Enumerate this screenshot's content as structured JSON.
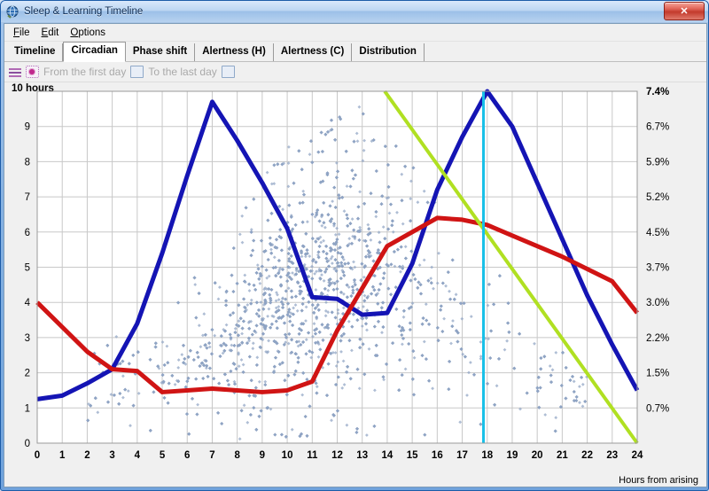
{
  "window": {
    "title": "Sleep & Learning Timeline",
    "app_icon": "globe-icon",
    "close_label": "✕"
  },
  "menubar": {
    "items": [
      {
        "label": "File",
        "mnemonic": "F"
      },
      {
        "label": "Edit",
        "mnemonic": "E"
      },
      {
        "label": "Options",
        "mnemonic": "O"
      }
    ]
  },
  "tabs": [
    {
      "label": "Timeline",
      "active": false
    },
    {
      "label": "Circadian",
      "active": true
    },
    {
      "label": "Phase shift",
      "active": false
    },
    {
      "label": "Alertness (H)",
      "active": false
    },
    {
      "label": "Alertness (C)",
      "active": false
    },
    {
      "label": "Distribution",
      "active": false
    }
  ],
  "toolbar": {
    "lines_icon": "lines-icon",
    "from_icon": "burst-icon",
    "from_label": "From the first day",
    "from_calendar_icon": "calendar-icon",
    "to_label": "To the last day",
    "to_calendar_icon": "calendar-icon"
  },
  "chart_data": {
    "type": "line",
    "title": "",
    "xlabel": "Hours from arising",
    "ylabel": "10 hours",
    "xlim": [
      0,
      24
    ],
    "ylim": [
      0,
      10
    ],
    "grid": true,
    "legend": "none",
    "x_ticks": [
      0,
      1,
      2,
      3,
      4,
      5,
      6,
      7,
      8,
      9,
      10,
      11,
      12,
      13,
      14,
      15,
      16,
      17,
      18,
      19,
      20,
      21,
      22,
      23,
      24
    ],
    "y_ticks_left": [
      "0",
      "1",
      "2",
      "3",
      "4",
      "5",
      "6",
      "7",
      "8",
      "9",
      "10 hours"
    ],
    "y_ticks_right": [
      "0.7%",
      "1.5%",
      "2.2%",
      "3.0%",
      "3.7%",
      "4.5%",
      "5.2%",
      "5.9%",
      "6.7%",
      "7.4%"
    ],
    "y_right_values": [
      0.7,
      1.5,
      2.2,
      3.0,
      3.7,
      4.5,
      5.2,
      5.9,
      6.7,
      7.4
    ],
    "y_right_positions": [
      1,
      2,
      3,
      4,
      5,
      6,
      7,
      8,
      9,
      10
    ],
    "series": [
      {
        "name": "circadian-blue",
        "color": "#1414b4",
        "width": 5,
        "x": [
          0,
          1,
          2,
          3,
          4,
          5,
          6,
          7,
          8,
          9,
          10,
          11,
          12,
          13,
          14,
          15,
          16,
          17,
          18,
          19,
          20,
          21,
          22,
          23,
          24
        ],
        "y": [
          1.25,
          1.35,
          1.7,
          2.1,
          3.4,
          5.4,
          7.6,
          9.7,
          8.6,
          7.4,
          6.1,
          4.15,
          4.1,
          3.65,
          3.7,
          5.1,
          7.2,
          8.7,
          10.0,
          9.0,
          7.4,
          5.8,
          4.2,
          2.8,
          1.5
        ]
      },
      {
        "name": "homeostatic-red",
        "color": "#d01414",
        "width": 5,
        "x": [
          0,
          1,
          2,
          3,
          4,
          5,
          6,
          7,
          8,
          9,
          10,
          11,
          12,
          13,
          14,
          15,
          16,
          17,
          18,
          19,
          20,
          21,
          22,
          23,
          24
        ],
        "y": [
          4.0,
          3.3,
          2.6,
          2.1,
          2.05,
          1.45,
          1.5,
          1.55,
          1.5,
          1.45,
          1.5,
          1.75,
          3.2,
          4.4,
          5.6,
          6.0,
          6.4,
          6.35,
          6.2,
          5.9,
          5.6,
          5.3,
          4.95,
          4.6,
          3.7
        ]
      },
      {
        "name": "alertness-green",
        "color": "#b0e022",
        "width": 4,
        "x": [
          13.9,
          24
        ],
        "y": [
          10.0,
          0.0
        ]
      },
      {
        "name": "current-time-marker",
        "color": "#18c0e8",
        "width": 3,
        "x": [
          17.85,
          17.85
        ],
        "y": [
          0.0,
          10.0
        ]
      }
    ],
    "scatter": {
      "name": "sleep-samples",
      "color": "#8fa3c4",
      "marker": "diamond",
      "size": 3,
      "density_note": "dense cloud concentrated between x=4 and x=20, centered around y=2..6"
    }
  }
}
